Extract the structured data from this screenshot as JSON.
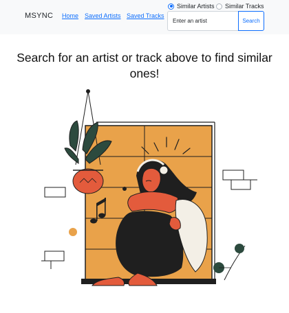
{
  "navbar": {
    "brand": "MSYNC",
    "links": [
      {
        "label": "Home"
      },
      {
        "label": "Saved Artists"
      },
      {
        "label": "Saved Tracks"
      }
    ]
  },
  "search": {
    "mode_options": [
      {
        "label": "Similar Artists",
        "selected": true
      },
      {
        "label": "Similar Tracks",
        "selected": false
      }
    ],
    "input_value": "",
    "placeholder": "Enter an artist",
    "button_label": "Search"
  },
  "main": {
    "headline": "Search for an artist or track above to find similar ones!"
  },
  "colors": {
    "navbar_bg": "#f8f9fa",
    "link": "#0d6efd",
    "accent_orange": "#e9a24a",
    "skin_red": "#e35b3c",
    "ink": "#1f1f1f"
  },
  "illustration": {
    "icon": "woman-with-headphones-illustration"
  }
}
